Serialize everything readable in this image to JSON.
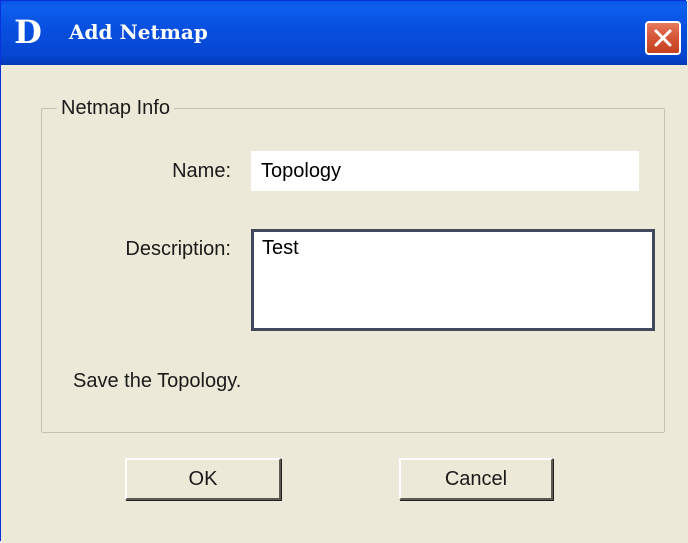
{
  "window": {
    "title": "Add Netmap",
    "logo_letter": "D",
    "close_icon": "close-x-icon"
  },
  "group": {
    "legend": "Netmap Info"
  },
  "form": {
    "name_label": "Name:",
    "name_value": "Topology",
    "description_label": "Description:",
    "description_value": "Test"
  },
  "status_text": "Save the Topology.",
  "buttons": {
    "ok_label": "OK",
    "cancel_label": "Cancel"
  },
  "colors": {
    "titlebar": "#0850e1",
    "close_button": "#d7573a",
    "dialog_background": "#ece9d8"
  }
}
